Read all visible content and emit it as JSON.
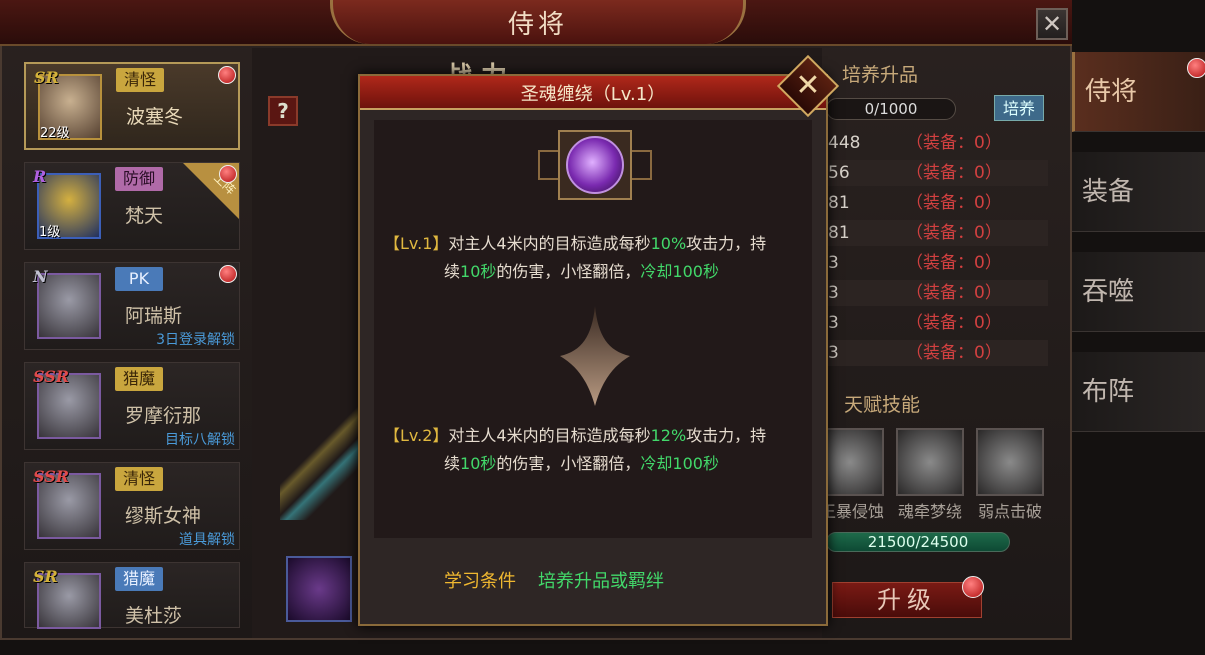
{
  "window": {
    "title": "侍将",
    "close_glyph": "✕"
  },
  "heroes": [
    {
      "rarity": "SR",
      "tag": "清怪",
      "name": "波塞冬",
      "level": "22级",
      "unlock": "",
      "selected": true
    },
    {
      "rarity": "R",
      "tag": "防御",
      "name": "梵天",
      "level": "1级",
      "unlock": "",
      "ribbon": "上阵"
    },
    {
      "rarity": "N",
      "tag": "PK",
      "name": "阿瑞斯",
      "level": "",
      "unlock": "3日登录解锁"
    },
    {
      "rarity": "SSR",
      "tag": "猎魔",
      "name": "罗摩衍那",
      "level": "",
      "unlock": "目标八解锁"
    },
    {
      "rarity": "SSR",
      "tag": "清怪",
      "name": "缪斯女神",
      "level": "",
      "unlock": "道具解锁"
    },
    {
      "rarity": "SR",
      "tag": "猎魔",
      "name": "美杜莎",
      "level": "",
      "unlock": ""
    }
  ],
  "center": {
    "help_glyph": "?",
    "power_label": "战 力"
  },
  "right_panel": {
    "train_title": "培养升品",
    "train_progress": "0/1000",
    "train_button": "培养",
    "stats": [
      {
        "value": "448",
        "equip": "（装备：0）"
      },
      {
        "value": "56",
        "equip": "（装备：0）"
      },
      {
        "value": "81",
        "equip": "（装备：0）"
      },
      {
        "value": "81",
        "equip": "（装备：0）"
      },
      {
        "value": "3",
        "equip": "（装备：0）"
      },
      {
        "value": "3",
        "equip": "（装备：0）"
      },
      {
        "value": "3",
        "equip": "（装备：0）"
      },
      {
        "value": "3",
        "equip": "（装备：0）"
      }
    ],
    "talent_title": "天赋技能",
    "talents": [
      "王暴侵蚀",
      "魂牵梦绕",
      "弱点击破"
    ],
    "exp": "21500/24500",
    "upgrade_button": "升级"
  },
  "side_tabs": [
    "侍将",
    "装备",
    "吞噬",
    "布阵"
  ],
  "dialog": {
    "title": "圣魂缠绕（Lv.1）",
    "close_glyph": "✕",
    "lv1": {
      "tag": "【Lv.1】",
      "p1": "对主人4米内的目标造成每秒",
      "pct": "10%",
      "p2": "攻击力，持",
      "p3": "续",
      "dur": "10秒",
      "p4": "的伤害，小怪翻倍，",
      "cd": "冷却100秒"
    },
    "lv2": {
      "tag": "【Lv.2】",
      "p1": "对主人4米内的目标造成每秒",
      "pct": "12%",
      "p2": "攻击力，持",
      "p3": "续",
      "dur": "10秒",
      "p4": "的伤害，小怪翻倍，",
      "cd": "冷却100秒"
    },
    "learn_label": "学习条件",
    "learn_value": "培养升品或羁绊"
  }
}
